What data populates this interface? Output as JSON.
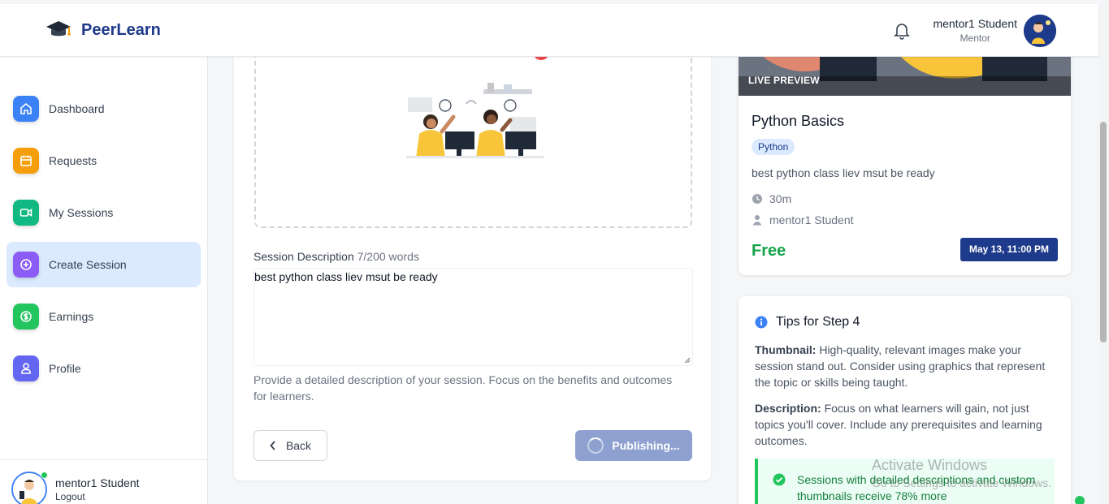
{
  "header": {
    "brand_name": "PeerLearn",
    "user_name": "mentor1 Student",
    "user_role": "Mentor"
  },
  "sidebar": {
    "items": [
      {
        "label": "Dashboard",
        "icon": "home-icon",
        "color": "#3b82f6"
      },
      {
        "label": "Requests",
        "icon": "calendar-icon",
        "color": "#f59e0b"
      },
      {
        "label": "My Sessions",
        "icon": "video-icon",
        "color": "#10b981"
      },
      {
        "label": "Create Session",
        "icon": "plus-circle-icon",
        "color": "#8b5cf6",
        "active": true
      },
      {
        "label": "Earnings",
        "icon": "dollar-icon",
        "color": "#22c55e"
      },
      {
        "label": "Profile",
        "icon": "user-icon",
        "color": "#6366f1"
      }
    ],
    "footer": {
      "name": "mentor1 Student",
      "logout_label": "Logout"
    }
  },
  "form": {
    "description_label": "Session Description",
    "word_count": "7/200 words",
    "description_value": "best python class liev msut be ready",
    "help_text": "Provide a detailed description of your session. Focus on the benefits and outcomes for learners.",
    "back_label": "Back",
    "publish_label": "Publishing..."
  },
  "preview": {
    "live_label": "LIVE PREVIEW",
    "title": "Python Basics",
    "tag": "Python",
    "description": "best python class liev msut be ready",
    "duration": "30m",
    "mentor": "mentor1 Student",
    "price": "Free",
    "date": "May 13, 11:00 PM"
  },
  "tips": {
    "title": "Tips for Step 4",
    "thumbnail_heading": "Thumbnail:",
    "thumbnail_text": "High-quality, relevant images make your session stand out. Consider using graphics that represent the topic or skills being taught.",
    "description_heading": "Description:",
    "description_text": "Focus on what learners will gain, not just topics you'll cover. Include any prerequisites and learning outcomes.",
    "success_text": "Sessions with detailed descriptions and custom thumbnails receive 78% more"
  },
  "watermark": {
    "line1": "Activate Windows",
    "line2": "Go to Settings to activate Windows."
  },
  "colors": {
    "brand": "#1e3a8a",
    "active_nav_bg": "#dbeafe",
    "price_green": "#16a34a",
    "publish_disabled": "#8ea0cf"
  }
}
